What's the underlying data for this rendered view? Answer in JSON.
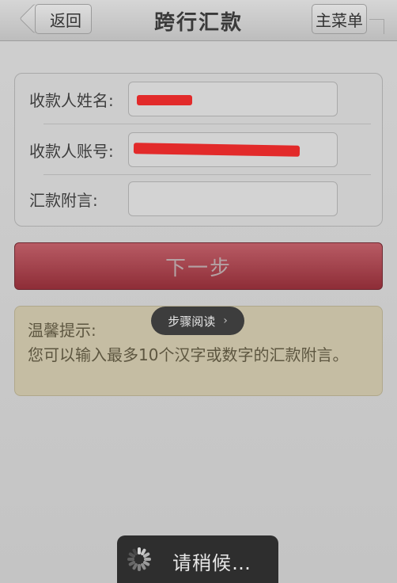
{
  "navbar": {
    "title": "跨行汇款",
    "back_label": "返回",
    "menu_label": "主菜单"
  },
  "form": {
    "payee_name_label": "收款人姓名:",
    "payee_account_label": "收款人账号:",
    "remark_label": "汇款附言:"
  },
  "next_button": {
    "label": "下一步"
  },
  "tip": {
    "title": "温馨提示:",
    "body": "您可以输入最多10个汉字或数字的汇款附言。"
  },
  "step_reading": {
    "label": "步骤阅读",
    "chevron": "›"
  },
  "loading": {
    "text": "请稍候…"
  },
  "colors": {
    "next_button": "#8e2d37",
    "tip_background": "#c5bda3",
    "redaction": "#e22a2a"
  }
}
